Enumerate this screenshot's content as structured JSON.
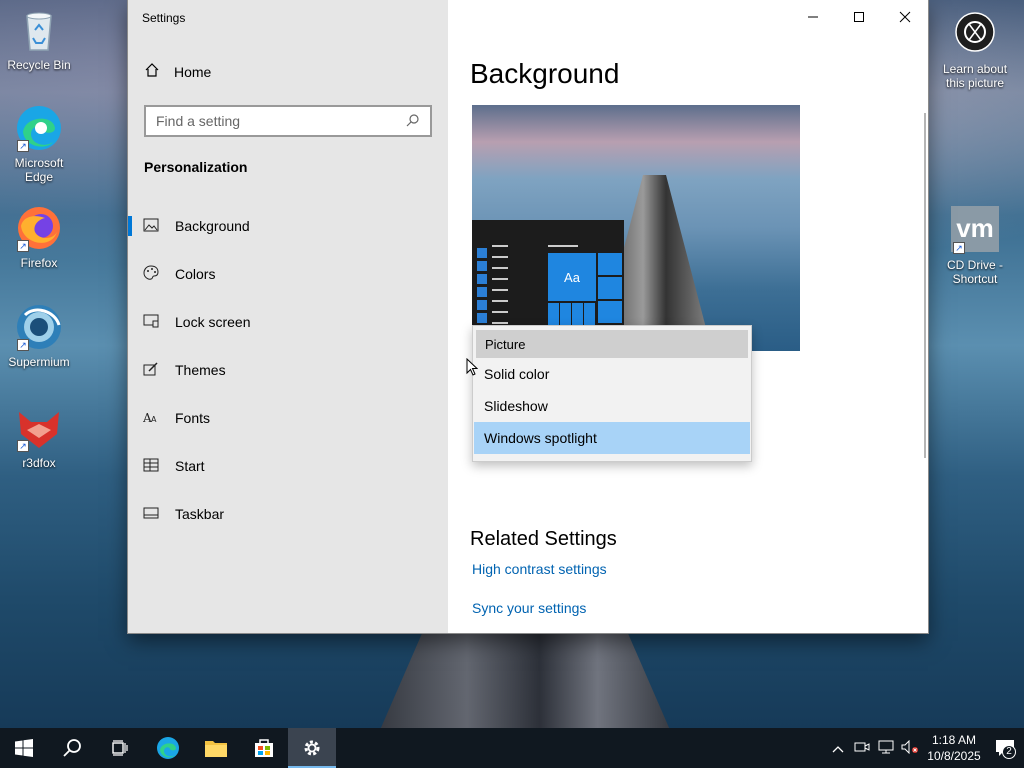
{
  "desktop": {
    "icons_left": [
      {
        "label": "Recycle Bin",
        "icon": "recycle-bin-icon"
      },
      {
        "label": "Microsoft Edge",
        "icon": "edge-icon"
      },
      {
        "label": "Firefox",
        "icon": "firefox-icon"
      },
      {
        "label": "Supermium",
        "icon": "supermium-icon"
      },
      {
        "label": "r3dfox",
        "icon": "r3dfox-icon"
      }
    ],
    "icons_right": [
      {
        "label": "Learn about this picture",
        "icon": "camera-icon"
      },
      {
        "label": "CD Drive - Shortcut",
        "icon": "vm-icon",
        "logo": "vm"
      }
    ]
  },
  "window": {
    "title": "Settings",
    "minimize": "—",
    "maximize": "☐",
    "close": "✕",
    "home_label": "Home",
    "search_placeholder": "Find a setting",
    "section": "Personalization",
    "nav": [
      {
        "label": "Background",
        "icon": "image-icon",
        "glyph": "🖾"
      },
      {
        "label": "Colors",
        "icon": "palette-icon",
        "glyph": "🎨"
      },
      {
        "label": "Lock screen",
        "icon": "lock-screen-icon",
        "glyph": "▭"
      },
      {
        "label": "Themes",
        "icon": "themes-icon",
        "glyph": "✎"
      },
      {
        "label": "Fonts",
        "icon": "fonts-icon",
        "glyph": "A"
      },
      {
        "label": "Start",
        "icon": "start-icon",
        "glyph": "▦"
      },
      {
        "label": "Taskbar",
        "icon": "taskbar-icon",
        "glyph": "▬"
      }
    ],
    "active_nav": "Background"
  },
  "main": {
    "title": "Background",
    "preview_tile_label": "Aa",
    "dropdown": {
      "options": [
        "Picture",
        "Solid color",
        "Slideshow",
        "Windows spotlight"
      ],
      "selected": "Picture",
      "hovered": "Windows spotlight"
    },
    "related_title": "Related Settings",
    "links": [
      "High contrast settings",
      "Sync your settings"
    ]
  },
  "taskbar": {
    "items": [
      {
        "name": "start-button",
        "icon": "windows-icon"
      },
      {
        "name": "search-button",
        "icon": "search-icon"
      },
      {
        "name": "task-view-button",
        "icon": "task-view-icon"
      },
      {
        "name": "edge-taskbar-button",
        "icon": "edge-icon"
      },
      {
        "name": "file-explorer-taskbar-button",
        "icon": "folder-icon"
      },
      {
        "name": "store-taskbar-button",
        "icon": "store-icon"
      },
      {
        "name": "settings-taskbar-button",
        "icon": "gear-icon"
      }
    ],
    "time": "1:18 AM",
    "date": "10/8/2025",
    "notification_count": "2"
  },
  "colors": {
    "accent": "#0078d7",
    "link": "#0063b1",
    "hover_option": "#a8d3f7",
    "taskbar": "#101820"
  }
}
